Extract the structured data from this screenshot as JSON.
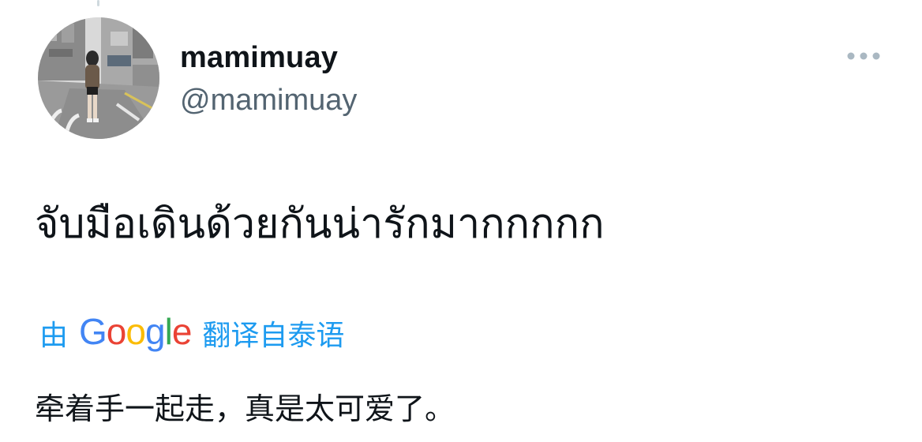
{
  "tweet": {
    "author": {
      "display_name": "mamimuay",
      "handle": "@mamimuay",
      "avatar_icon": "street-photo-avatar"
    },
    "more_icon": "more-dots-icon",
    "text": "จับมือเดินด้วยกันน่ารักมากกกกก"
  },
  "translation": {
    "prefix": "由",
    "provider": {
      "letters": [
        "G",
        "o",
        "o",
        "g",
        "l",
        "e"
      ],
      "colors": [
        "#4285F4",
        "#EA4335",
        "#FBBC05",
        "#4285F4",
        "#34A853",
        "#EA4335"
      ]
    },
    "link_label": "翻译自泰语",
    "text": "牵着手一起走，真是太可爱了。"
  },
  "colors": {
    "accent": "#1d9bf0",
    "secondary_text": "#536471",
    "primary_text": "#0f1419"
  }
}
